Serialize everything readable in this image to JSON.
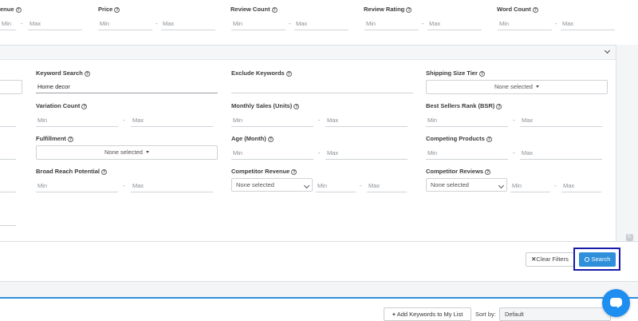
{
  "top_filters": {
    "revenue_label": "enue",
    "price_label": "Price",
    "review_count_label": "Review Count",
    "review_rating_label": "Review Rating",
    "word_count_label": "Word Count",
    "min": "Min",
    "max": "Max",
    "dash": "-"
  },
  "filters": {
    "keyword_search_label": "Keyword Search",
    "keyword_search_value": "Home decor",
    "exclude_keywords_label": "Exclude Keywords",
    "shipping_size_tier_label": "Shipping Size Tier",
    "shipping_size_tier_value": "None selected",
    "variation_count_label": "Variation Count",
    "monthly_sales_label": "Monthly Sales (Units)",
    "bsr_label": "Best Sellers Rank (BSR)",
    "fulfillment_label": "Fulfillment",
    "fulfillment_value": "None selected",
    "age_label": "Age (Month)",
    "competing_products_label": "Competing Products",
    "broad_reach_label": "Broad Reach Potential",
    "competitor_revenue_label": "Competitor Revenue",
    "competitor_revenue_select": "None selected",
    "competitor_reviews_label": "Competitor Reviews",
    "competitor_reviews_select": "None selected",
    "min": "Min",
    "max": "Max",
    "dash": "-"
  },
  "actions": {
    "clear_filters": "Clear Filters",
    "search": "Search"
  },
  "bottom": {
    "add_keywords": "Add Keywords to My List",
    "sort_by_label": "Sort by:",
    "sort_by_value": "Default"
  },
  "colors": {
    "accent": "#2f8fdb",
    "highlight_border": "#1a1aa8",
    "chat_bubble": "#1f8ef1"
  }
}
